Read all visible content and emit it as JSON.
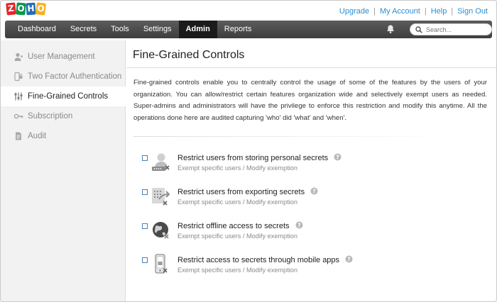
{
  "brand": {
    "logo_letters": [
      "Z",
      "O",
      "H",
      "O"
    ],
    "logo_colors": [
      "#e42527",
      "#089949",
      "#226db4",
      "#f9b21d"
    ]
  },
  "top_links": [
    "Upgrade",
    "My Account",
    "Help",
    "Sign Out"
  ],
  "nav": {
    "items": [
      "Dashboard",
      "Secrets",
      "Tools",
      "Settings",
      "Admin",
      "Reports"
    ],
    "active": "Admin"
  },
  "search": {
    "placeholder": "Search..."
  },
  "sidebar": {
    "items": [
      {
        "label": "User Management",
        "icon": "user-icon"
      },
      {
        "label": "Two Factor Authentication",
        "icon": "two-factor-icon"
      },
      {
        "label": "Fine-Grained Controls",
        "icon": "sliders-icon"
      },
      {
        "label": "Subscription",
        "icon": "key-icon"
      },
      {
        "label": "Audit",
        "icon": "document-icon"
      }
    ],
    "active": "Fine-Grained Controls"
  },
  "main": {
    "title": "Fine-Grained Controls",
    "description": "Fine-grained controls enable you to centrally control the usage of some of the features by the users of your organization. You can allow/restrict certain features organization wide and selectively exempt users as needed. Super-admins and administrators will have the privilege to enforce this restriction and modify this anytime. All the operations done here are audited capturing 'who' did 'what' and 'when'.",
    "options": [
      {
        "title": "Restrict users from storing personal secrets",
        "sub": "Exempt specific users / Modify exemption",
        "icon": "personal-secrets-icon",
        "checked": false
      },
      {
        "title": "Restrict users from exporting secrets",
        "sub": "Exempt specific users / Modify exemption",
        "icon": "export-secrets-icon",
        "checked": false
      },
      {
        "title": "Restrict offline access to secrets",
        "sub": "Exempt specific users / Modify exemption",
        "icon": "offline-access-icon",
        "checked": false
      },
      {
        "title": "Restrict access to secrets through mobile apps",
        "sub": "Exempt specific users / Modify exemption",
        "icon": "mobile-access-icon",
        "checked": false
      }
    ]
  },
  "colors": {
    "link": "#2a8fd0",
    "nav_bg": "#4a4a4a",
    "nav_active": "#1b1b1b",
    "checkbox_border": "#4a7fb5"
  }
}
